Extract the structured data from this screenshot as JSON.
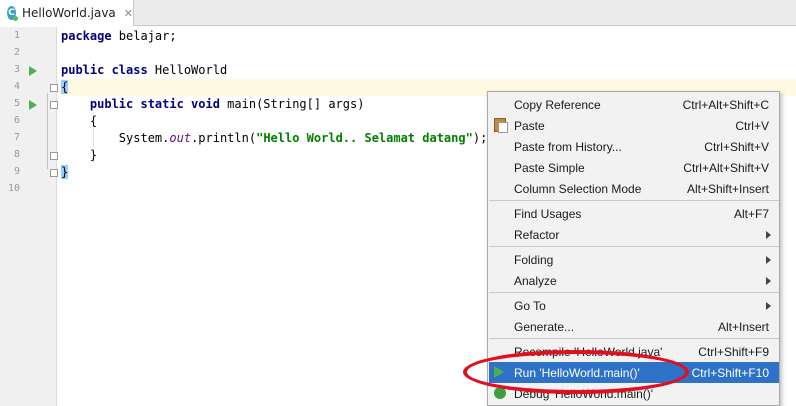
{
  "tab": {
    "filename": "HelloWorld.java",
    "icon_letter": "C",
    "close_glyph": "✕"
  },
  "line_numbers": [
    "1",
    "2",
    "3",
    "4",
    "5",
    "6",
    "7",
    "8",
    "9",
    "10"
  ],
  "code": {
    "l1_kw": "package",
    "l1_rest": " belajar;",
    "l3_kw": "public class",
    "l3_rest": " HelloWorld",
    "l4_brace": "{",
    "l5_indent": "    ",
    "l5_kw": "public static void",
    "l5_rest": " main(String[] args)",
    "l6": "    {",
    "l7_pre": "        System.",
    "l7_field": "out",
    "l7_mid": ".println(",
    "l7_str": "\"Hello World.. Selamat datang\"",
    "l7_post": ");",
    "l8": "    }",
    "l9_brace": "}"
  },
  "context_menu": {
    "items": [
      {
        "label": "Copy Reference",
        "shortcut": "Ctrl+Alt+Shift+C"
      },
      {
        "label": "Paste",
        "shortcut": "Ctrl+V"
      },
      {
        "label": "Paste from History...",
        "shortcut": "Ctrl+Shift+V"
      },
      {
        "label": "Paste Simple",
        "shortcut": "Ctrl+Alt+Shift+V"
      },
      {
        "label": "Column Selection Mode",
        "shortcut": "Alt+Shift+Insert"
      },
      {
        "label": "Find Usages",
        "shortcut": "Alt+F7"
      },
      {
        "label": "Refactor",
        "shortcut": ""
      },
      {
        "label": "Folding",
        "shortcut": ""
      },
      {
        "label": "Analyze",
        "shortcut": ""
      },
      {
        "label": "Go To",
        "shortcut": ""
      },
      {
        "label": "Generate...",
        "shortcut": "Alt+Insert"
      },
      {
        "label": "Recompile 'HelloWorld.java'",
        "shortcut": "Ctrl+Shift+F9"
      },
      {
        "label": "Run 'HelloWorld.main()'",
        "shortcut": "Ctrl+Shift+F10"
      },
      {
        "label": "Debug 'HelloWorld.main()'",
        "shortcut": ""
      }
    ],
    "selected_label": "Run 'HelloWorld.main()'"
  },
  "icons": {
    "tab": "java-class-icon",
    "paste": "clipboard-icon",
    "run": "run-play-icon",
    "debug": "debug-bug-icon",
    "submenu": "submenu-arrow-icon"
  },
  "colors": {
    "selection": "#2e72c8",
    "annotation": "#e01020",
    "keyword": "#000080",
    "string": "#008000",
    "caret_line": "#fffae3"
  }
}
